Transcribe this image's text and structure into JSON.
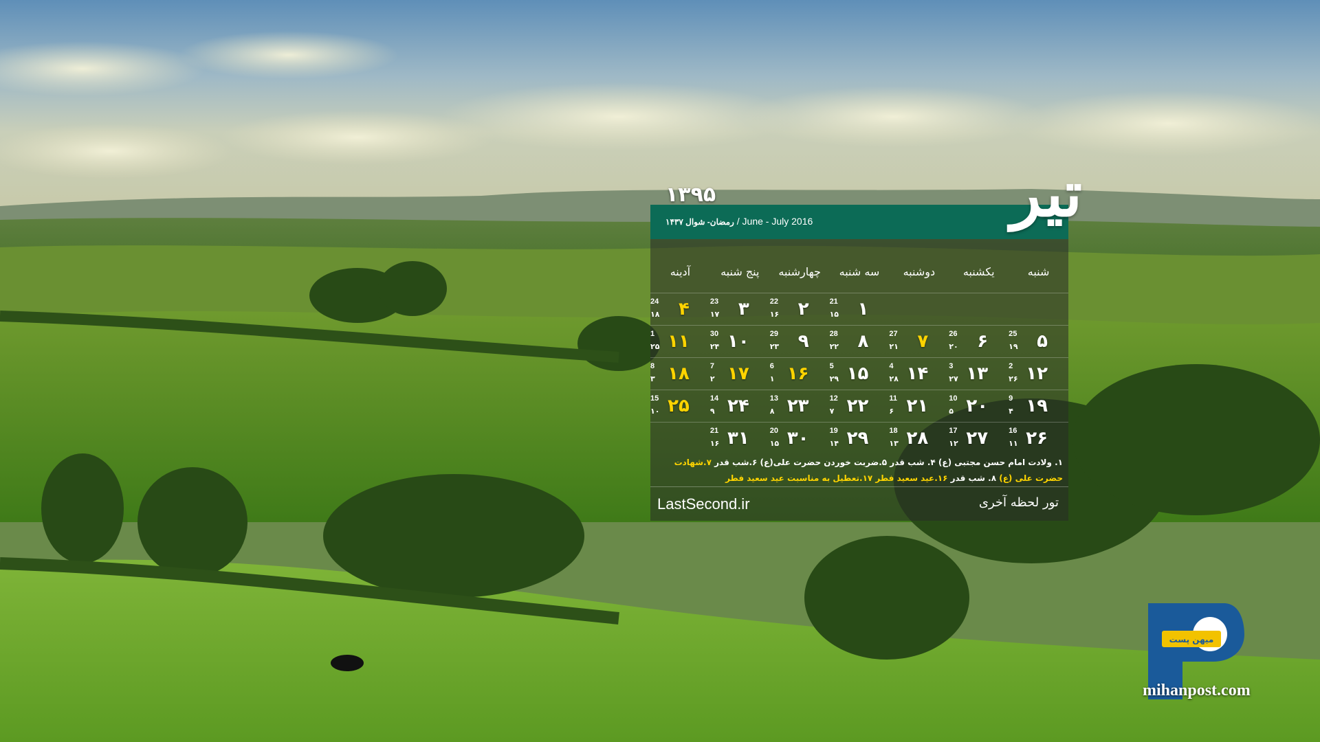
{
  "calendar": {
    "year": "۱۳۹۵",
    "month": "تیر",
    "header_gregorian": "/ June - July  2016",
    "header_hijri": "رمضان- شوال ۱۴۳۷",
    "weekdays": [
      "شنبه",
      "یکشنبه",
      "دوشنبه",
      "سه شنبه",
      "چهارشنبه",
      "پنج شنبه",
      "آدینه"
    ],
    "weeks": [
      [
        {
          "day": "",
          "g": "",
          "h": ""
        },
        {
          "day": "",
          "g": "",
          "h": ""
        },
        {
          "day": "",
          "g": "",
          "h": ""
        },
        {
          "day": "۱",
          "g": "21",
          "h": "۱۵"
        },
        {
          "day": "۲",
          "g": "22",
          "h": "۱۶"
        },
        {
          "day": "۳",
          "g": "23",
          "h": "۱۷"
        },
        {
          "day": "۴",
          "g": "24",
          "h": "۱۸",
          "holiday": true
        }
      ],
      [
        {
          "day": "۵",
          "g": "25",
          "h": "۱۹"
        },
        {
          "day": "۶",
          "g": "26",
          "h": "۲۰"
        },
        {
          "day": "۷",
          "g": "27",
          "h": "۲۱",
          "holiday": true
        },
        {
          "day": "۸",
          "g": "28",
          "h": "۲۲"
        },
        {
          "day": "۹",
          "g": "29",
          "h": "۲۳"
        },
        {
          "day": "۱۰",
          "g": "30",
          "h": "۲۴"
        },
        {
          "day": "۱۱",
          "g": "1",
          "h": "۲۵",
          "holiday": true
        }
      ],
      [
        {
          "day": "۱۲",
          "g": "2",
          "h": "۲۶"
        },
        {
          "day": "۱۳",
          "g": "3",
          "h": "۲۷"
        },
        {
          "day": "۱۴",
          "g": "4",
          "h": "۲۸"
        },
        {
          "day": "۱۵",
          "g": "5",
          "h": "۲۹"
        },
        {
          "day": "۱۶",
          "g": "6",
          "h": "۱",
          "holiday": true
        },
        {
          "day": "۱۷",
          "g": "7",
          "h": "۲",
          "holiday": true
        },
        {
          "day": "۱۸",
          "g": "8",
          "h": "۳",
          "holiday": true
        }
      ],
      [
        {
          "day": "۱۹",
          "g": "9",
          "h": "۴"
        },
        {
          "day": "۲۰",
          "g": "10",
          "h": "۵"
        },
        {
          "day": "۲۱",
          "g": "11",
          "h": "۶"
        },
        {
          "day": "۲۲",
          "g": "12",
          "h": "۷"
        },
        {
          "day": "۲۳",
          "g": "13",
          "h": "۸"
        },
        {
          "day": "۲۴",
          "g": "14",
          "h": "۹"
        },
        {
          "day": "۲۵",
          "g": "15",
          "h": "۱۰",
          "holiday": true
        }
      ],
      [
        {
          "day": "۲۶",
          "g": "16",
          "h": "۱۱"
        },
        {
          "day": "۲۷",
          "g": "17",
          "h": "۱۲"
        },
        {
          "day": "۲۸",
          "g": "18",
          "h": "۱۳"
        },
        {
          "day": "۲۹",
          "g": "19",
          "h": "۱۴"
        },
        {
          "day": "۳۰",
          "g": "20",
          "h": "۱۵"
        },
        {
          "day": "۳۱",
          "g": "21",
          "h": "۱۶"
        },
        {
          "day": "",
          "g": "",
          "h": ""
        }
      ]
    ],
    "events_line1": "۱. ولادت امام حسن مجتبی (ع)    ۴. شب قدر    ۵.ضربت خوردن حضرت علی(ع)   ۶.شب قدر",
    "events_line1_yellow": "۷.شهادت",
    "events_line2_yellow_a": "حضرت علی (ع)",
    "events_line2": "   ۸. شب قدر   ",
    "events_line2_yellow_b": "۱۶.عید سعید فطر   ۱۷.تعطیل به مناسبت عید سعید فطر",
    "promo_text": "تور لحظه آخری",
    "promo_site": "LastSecond.ir"
  },
  "logo": {
    "url_text": "mihanpost.com",
    "badge_text": "میهن پست"
  },
  "colors": {
    "header_green": "#0c6b56",
    "holiday_yellow": "#ffd400",
    "logo_blue": "#1a5a9a"
  }
}
